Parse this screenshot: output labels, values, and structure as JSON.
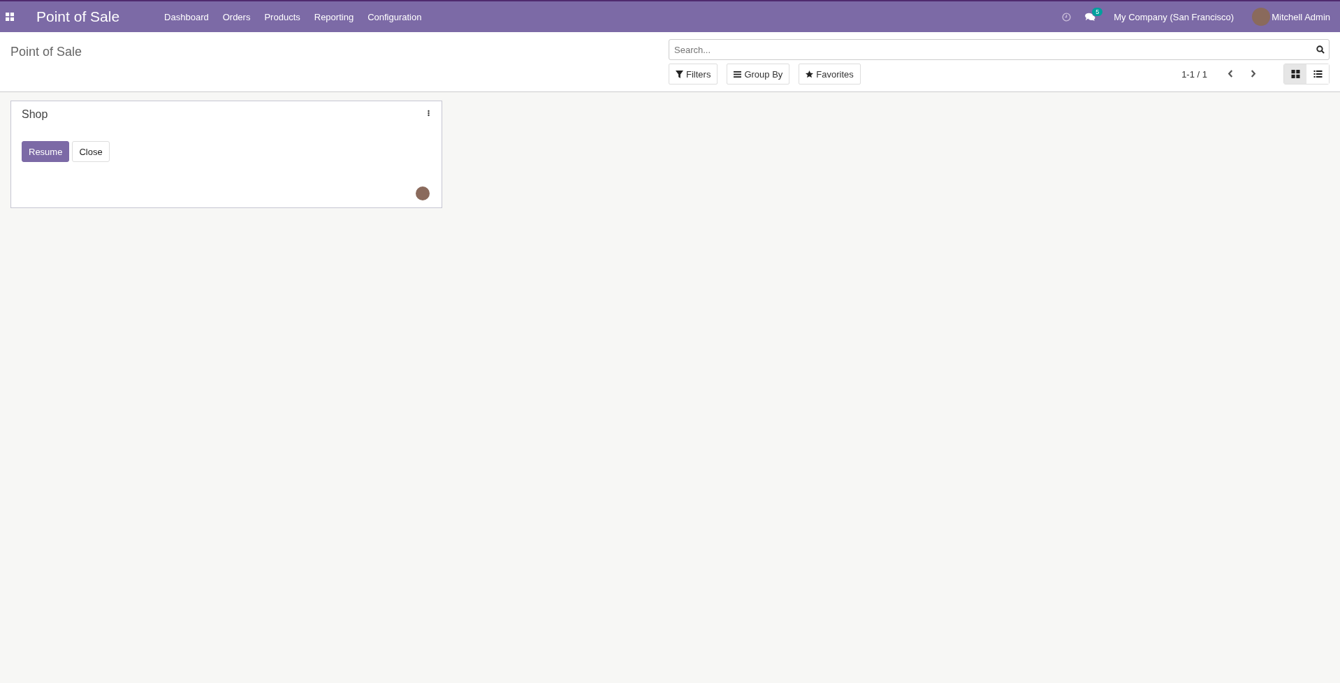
{
  "navbar": {
    "app_title": "Point of Sale",
    "menu": [
      "Dashboard",
      "Orders",
      "Products",
      "Reporting",
      "Configuration"
    ],
    "message_count": "5",
    "company": "My Company (San Francisco)",
    "user": "Mitchell Admin"
  },
  "control_panel": {
    "breadcrumb": "Point of Sale",
    "search": {
      "placeholder": "Search..."
    },
    "filters": [
      "Filters",
      "Group By",
      "Favorites"
    ],
    "pager": "1-1 / 1",
    "views": [
      {
        "kind": "kanban",
        "selected": true
      },
      {
        "kind": "list",
        "selected": false
      }
    ]
  },
  "cards": [
    {
      "title": "Shop",
      "buttons": [
        {
          "label": "Resume",
          "kind": "primary"
        },
        {
          "label": "Close",
          "kind": "secondary"
        }
      ]
    }
  ]
}
